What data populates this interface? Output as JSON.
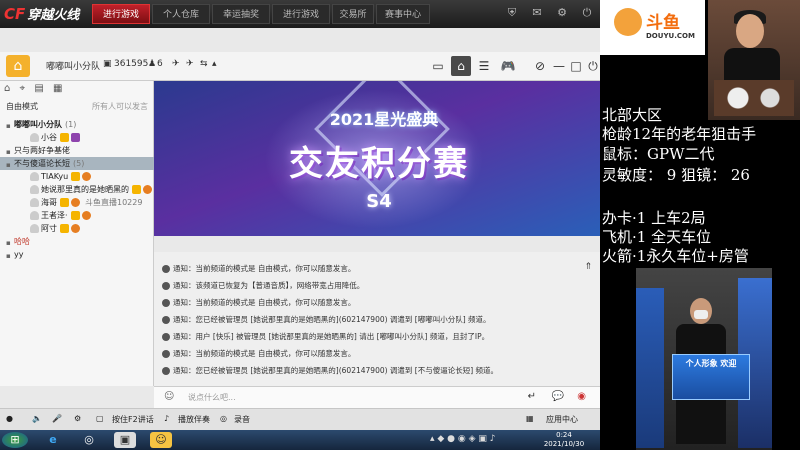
{
  "app": {
    "logo_text": "穿越火线",
    "nav_tabs": [
      "进行游戏",
      "个人仓库",
      "幸运抽奖",
      "进行游戏",
      "交易所",
      "赛事中心"
    ],
    "active_tab": 0
  },
  "room": {
    "name": "嘟嘟叫小分队",
    "id": "361595",
    "members": "6"
  },
  "left_panel": {
    "mode_label": "自由模式",
    "mode_hint": "所有人可以发言",
    "tree": [
      {
        "label": "嘟嘟叫小分队",
        "count": "(1)",
        "indent": 0,
        "bold": true,
        "selected": false,
        "type": "channel"
      },
      {
        "label": "小谷",
        "count": "",
        "indent": 2,
        "bold": false,
        "selected": false,
        "type": "user"
      },
      {
        "label": "只与两好争基佬",
        "count": "",
        "indent": 0,
        "bold": false,
        "selected": false,
        "type": "channel"
      },
      {
        "label": "不与傻逼论长短",
        "count": "(5)",
        "indent": 0,
        "bold": false,
        "selected": true,
        "type": "channel"
      },
      {
        "label": "TIAKyu",
        "count": "",
        "indent": 2,
        "bold": false,
        "selected": false,
        "type": "user"
      },
      {
        "label": "她说那里真的是她晒黑的",
        "count": "",
        "indent": 2,
        "bold": false,
        "selected": false,
        "type": "user"
      },
      {
        "label": "海哥",
        "count": "斗鱼直播10229",
        "indent": 2,
        "bold": false,
        "selected": false,
        "type": "user"
      },
      {
        "label": "王者泽·",
        "count": "",
        "indent": 2,
        "bold": false,
        "selected": false,
        "type": "user"
      },
      {
        "label": "阿寸",
        "count": "",
        "indent": 2,
        "bold": false,
        "selected": false,
        "type": "user"
      },
      {
        "label": "哈哈",
        "count": "",
        "indent": 0,
        "bold": false,
        "selected": false,
        "type": "red"
      },
      {
        "label": "yy",
        "count": "",
        "indent": 0,
        "bold": false,
        "selected": false,
        "type": "channel"
      }
    ]
  },
  "banner": {
    "year": "2021星光盛典",
    "title": "交友积分赛",
    "season": "S4"
  },
  "messages": [
    "通知：当前频道的模式是 自由模式，你可以随意发言。",
    "通知：该频道已恢复为【普通音质】，网络带宽占用降低。",
    "通知：当前频道的模式是 自由模式，你可以随意发言。",
    "通知：您已经被管理员 [她说那里真的是她晒黑的](602147900) 调遣到 [嘟嘟叫小分队] 频道。",
    "通知：用户 [快乐] 被管理员 [她说那里真的是她晒黑的] 请出 [嘟嘟叫小分队] 频道，且封了IP。",
    "通知：当前频道的模式是 自由模式，你可以随意发言。",
    "通知：您已经被管理员 [她说那里真的是她晒黑的](602147900) 调遣到 [不与傻逼论长短] 频道。"
  ],
  "input": {
    "placeholder": "说点什么吧..."
  },
  "bottom_bar": {
    "ptt": "按住F2讲话",
    "accompany": "播放伴奏",
    "record": "录音",
    "app_center": "应用中心"
  },
  "taskbar": {
    "time": "0:24",
    "date": "2021/10/30"
  },
  "douyu": {
    "name": "斗鱼",
    "url": "DOUYU.COM"
  },
  "streamer_info": [
    "北部大区",
    "枪龄12年的老年狙击手",
    "鼠标：GPW二代",
    "灵敏度： 9 狙镜： 26",
    "",
    "办卡·1 上车2局",
    "飞机·1 全天车位",
    "火箭·1永久车位+房管"
  ],
  "poster_text": "个人形象 欢迎"
}
